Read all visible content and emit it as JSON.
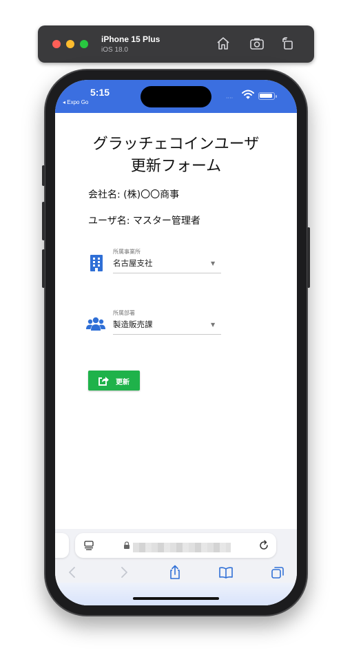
{
  "simulator": {
    "device_name": "iPhone 15 Plus",
    "os_version": "iOS 18.0",
    "icons": [
      "home-icon",
      "screenshot-icon",
      "rotate-icon"
    ]
  },
  "status_bar": {
    "time": "5:15",
    "back_app": "◂ Expo Go",
    "signal": "····",
    "accent_color": "#3b6fe0"
  },
  "form": {
    "title_line1": "グラッチェコインユーザ",
    "title_line2": "更新フォーム",
    "company": "会社名: (株)〇〇商事",
    "user": "ユーザ名: マスター管理者",
    "office": {
      "label": "所属事業所",
      "value": "名古屋支社",
      "icon": "building-icon"
    },
    "department": {
      "label": "所属部署",
      "value": "製造販売課",
      "icon": "users-icon"
    },
    "update_button": {
      "label": "更新",
      "icon": "share-square-icon",
      "color": "#1fb24a"
    }
  },
  "safari": {
    "icons": [
      "reader-icon",
      "lock-icon",
      "reload-icon",
      "back-icon",
      "forward-icon",
      "share-icon",
      "bookmarks-icon",
      "tabs-icon"
    ]
  }
}
